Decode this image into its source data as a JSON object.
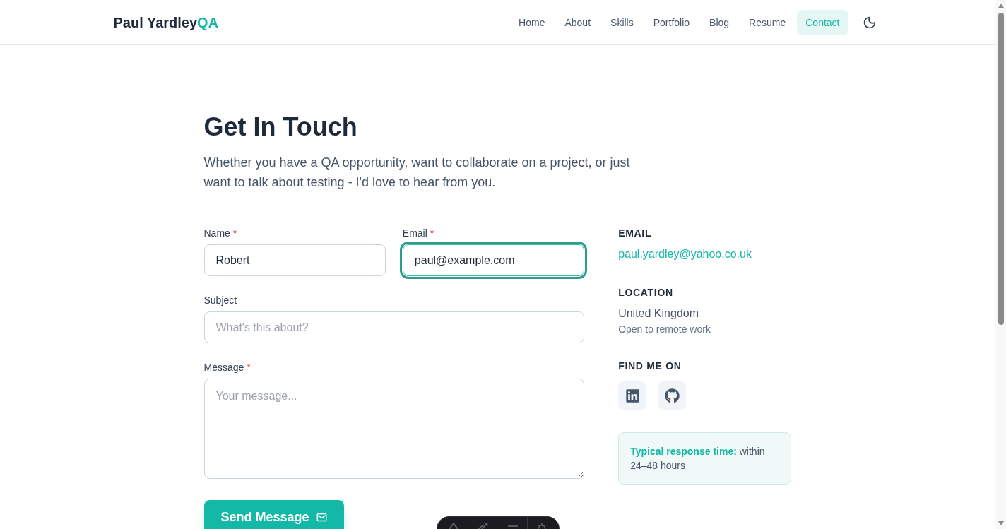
{
  "header": {
    "logo": {
      "name": "Paul Yardley",
      "accent": "QA"
    },
    "nav": [
      {
        "label": "Home",
        "selected": false
      },
      {
        "label": "About",
        "selected": false
      },
      {
        "label": "Skills",
        "selected": false
      },
      {
        "label": "Portfolio",
        "selected": false
      },
      {
        "label": "Blog",
        "selected": false
      },
      {
        "label": "Resume",
        "selected": false
      },
      {
        "label": "Contact",
        "selected": true
      }
    ]
  },
  "hero": {
    "title": "Get In Touch",
    "intro": "Whether you have a QA opportunity, want to collaborate on a project, or just want to talk about testing - I'd love to hear from you."
  },
  "form": {
    "required_mark": "*",
    "rows": [
      {
        "fields": [
          {
            "kind": "input",
            "label": "Name",
            "required": true,
            "value": "Robert",
            "focused": false
          },
          {
            "kind": "input",
            "label": "Email",
            "required": true,
            "value": "paul@example.com",
            "focused": true
          }
        ]
      },
      {
        "fields": [
          {
            "kind": "input",
            "label": "Subject",
            "required": false,
            "placeholder": "What's this about?",
            "focused": false
          }
        ]
      },
      {
        "fields": [
          {
            "kind": "textarea",
            "label": "Message",
            "required": true,
            "placeholder": "Your message...",
            "focused": false
          }
        ]
      }
    ],
    "submit": "Send Message"
  },
  "contact_info": {
    "email": {
      "heading": "EMAIL",
      "address": "paul.yardley@yahoo.co.uk"
    },
    "location": {
      "heading": "LOCATION",
      "place": "United Kingdom",
      "note": "Open to remote work"
    },
    "social": {
      "heading": "FIND ME ON",
      "links": [
        {
          "kind": "linkedin"
        },
        {
          "kind": "github"
        }
      ]
    },
    "response_note": "**Typical response time:** within 24–48 hours"
  }
}
